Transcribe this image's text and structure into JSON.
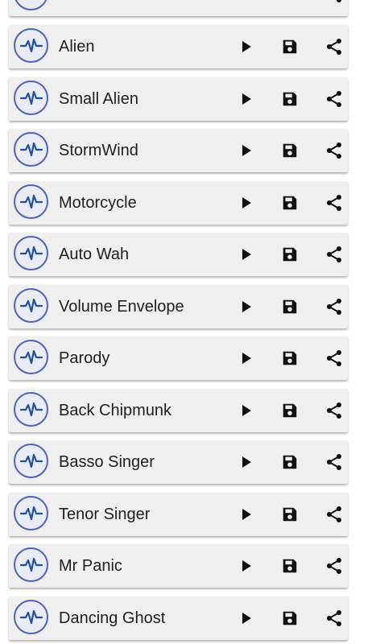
{
  "effects": [
    {
      "label": "Alien",
      "icon": "waveform-icon"
    },
    {
      "label": "Small Alien",
      "icon": "waveform-icon"
    },
    {
      "label": "StormWind",
      "icon": "waveform-icon"
    },
    {
      "label": "Motorcycle",
      "icon": "waveform-icon"
    },
    {
      "label": "Auto Wah",
      "icon": "waveform-icon"
    },
    {
      "label": "Volume Envelope",
      "icon": "waveform-icon"
    },
    {
      "label": "Parody",
      "icon": "waveform-icon"
    },
    {
      "label": "Back Chipmunk",
      "icon": "waveform-icon"
    },
    {
      "label": "Basso Singer",
      "icon": "waveform-icon"
    },
    {
      "label": "Tenor Singer",
      "icon": "waveform-icon"
    },
    {
      "label": "Mr Panic",
      "icon": "waveform-icon"
    },
    {
      "label": "Dancing Ghost",
      "icon": "waveform-icon"
    }
  ],
  "actions": {
    "play_icon": "play-icon",
    "save_icon": "save-icon",
    "share_icon": "share-icon"
  },
  "colors": {
    "accent": "#4f63b8",
    "row_background": "#efefef",
    "icon": "#111111"
  }
}
